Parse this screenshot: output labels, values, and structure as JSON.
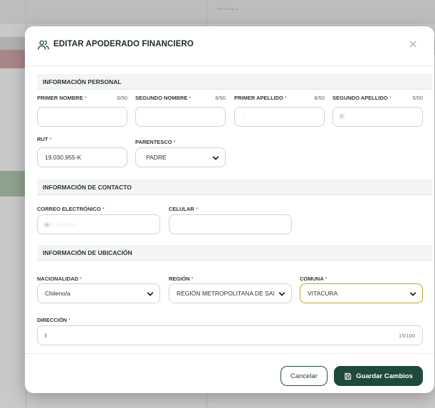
{
  "background": {
    "top_text": "PASO\nResidente"
  },
  "modal": {
    "title": "EDITAR APODERADO FINANCIERO",
    "header_icon": "users-icon",
    "close_icon": "close-icon"
  },
  "personal": {
    "section_title": "INFORMACIÓN PERSONAL",
    "primer_nombre": {
      "label": "PRIMER NOMBRE",
      "counter": "6/50",
      "value": ""
    },
    "segundo_nombre": {
      "label": "SEGUNDO NOMBRE",
      "counter": "6/50",
      "value": ""
    },
    "primer_apellido": {
      "label": "PRIMER APELLIDO",
      "counter": "8/50",
      "value": "·"
    },
    "segundo_apellido": {
      "label": "SEGUNDO APELLIDO",
      "counter": "5/50",
      "value": "F"
    },
    "rut": {
      "label": "RUT",
      "value": "19.030.955-K"
    },
    "parentesco": {
      "label": "PARENTESCO",
      "value": "PADRE"
    }
  },
  "contacto": {
    "section_title": "INFORMACIÓN DE CONTACTO",
    "correo": {
      "label": "CORREO ELECTRÓNICO",
      "value": "a··· ·· ·······"
    },
    "celular": {
      "label": "CELULAR",
      "value": ""
    }
  },
  "ubicacion": {
    "section_title": "INFORMACIÓN DE UBICACIÓN",
    "nacionalidad": {
      "label": "NACIONALIDAD",
      "value": "Chileno/a"
    },
    "region": {
      "label": "REGIÓN",
      "value": "REGIÓN METROPOLITANA DE SAN"
    },
    "comuna": {
      "label": "COMUNA",
      "value": "VITACURA"
    },
    "direccion": {
      "label": "DIRECCIÓN",
      "value": "I",
      "counter": "15/100"
    }
  },
  "required_mark": "*",
  "footer": {
    "cancel_label": "Cancelar",
    "save_label": "Guardar Cambios",
    "save_icon": "save-icon"
  },
  "colors": {
    "primary": "#1d4a3a",
    "required": "#e03131",
    "active_border": "#c9a227"
  }
}
